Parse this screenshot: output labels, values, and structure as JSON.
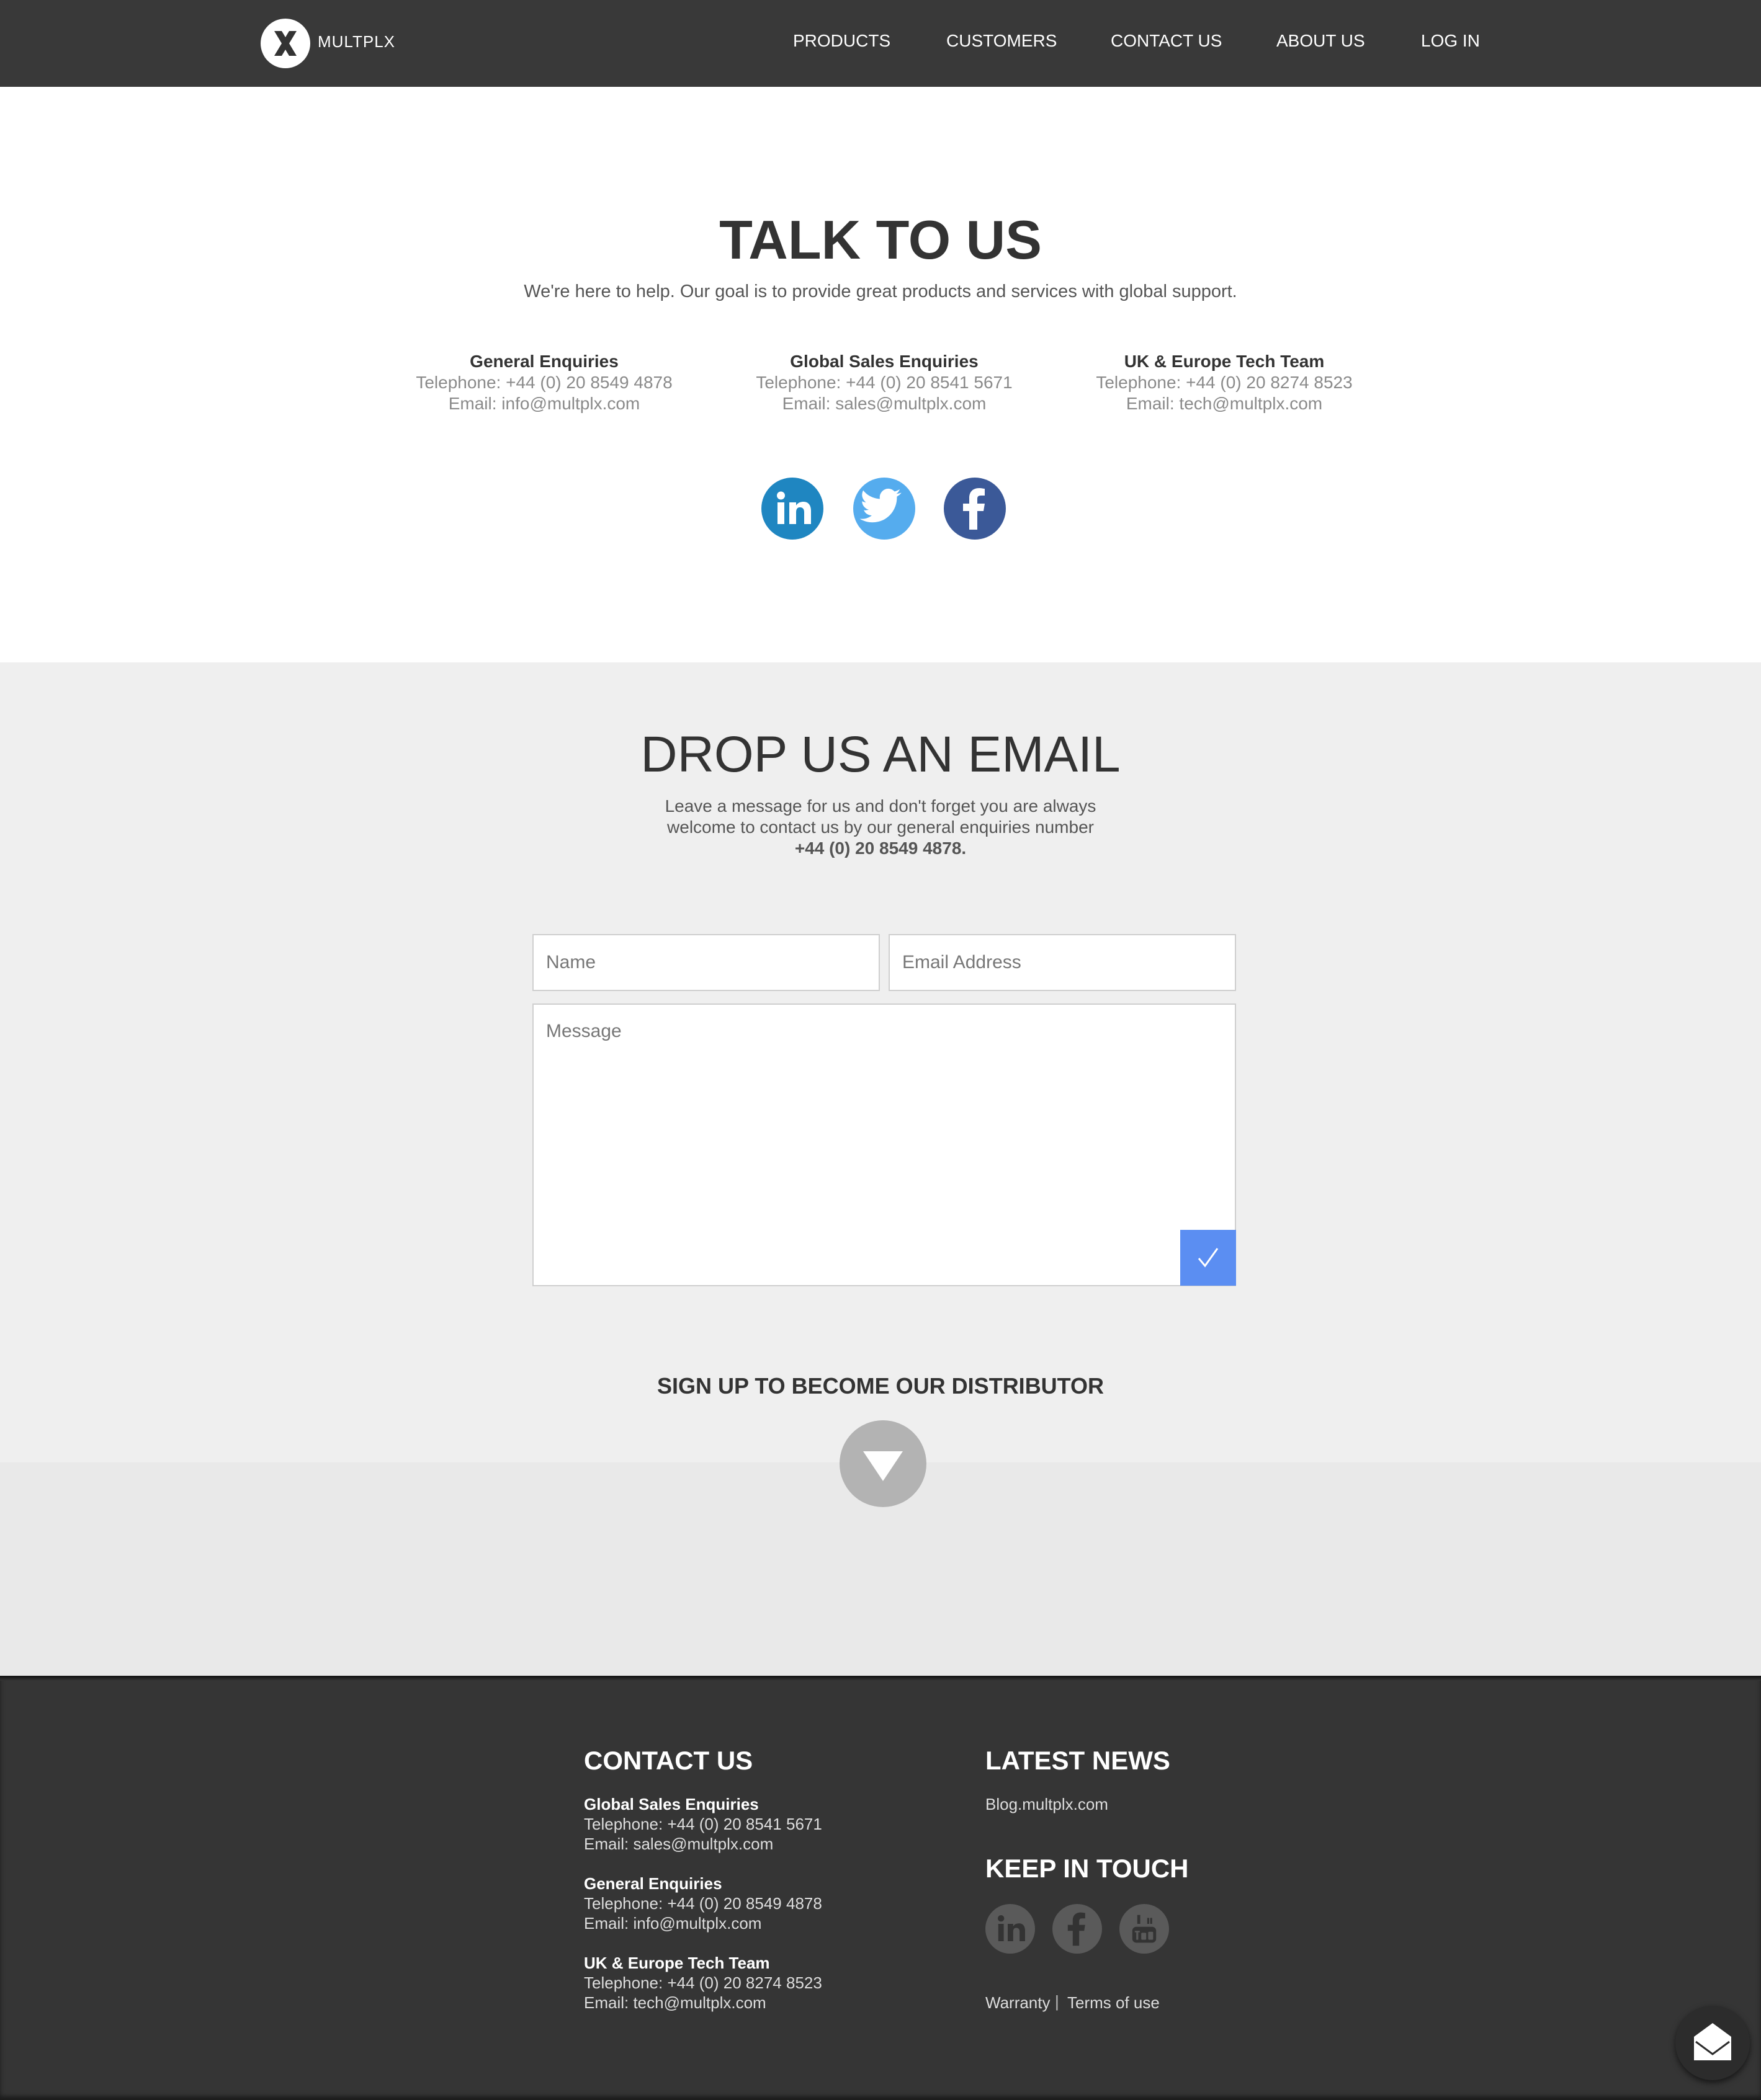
{
  "header": {
    "logo_text": "MULTPLX",
    "nav": [
      "PRODUCTS",
      "CUSTOMERS",
      "CONTACT US",
      "ABOUT US",
      "LOG IN"
    ]
  },
  "talk": {
    "title": "TALK TO US",
    "subtitle": "We're here to help. Our goal is to provide great products and services with global support.",
    "contacts": [
      {
        "title": "General Enquiries",
        "phone": "Telephone: +44 (0) 20 8549 4878",
        "email": "Email: info@multplx.com"
      },
      {
        "title": "Global Sales Enquiries",
        "phone": "Telephone: +44 (0) 20 8541 5671",
        "email": "Email: sales@multplx.com"
      },
      {
        "title": "UK & Europe Tech Team",
        "phone": "Telephone: +44 (0) 20 8274 8523",
        "email": "Email: tech@multplx.com"
      }
    ],
    "social_icons": [
      "linkedin-icon",
      "twitter-icon",
      "facebook-icon"
    ],
    "social_colors": [
      "#1f86c1",
      "#55acee",
      "#3b5998"
    ]
  },
  "drop": {
    "title": "DROP US AN EMAIL",
    "line1": "Leave a message for us and don't forget you are always",
    "line2": "welcome to contact us by our general enquiries number",
    "line3": "+44 (0) 20 8549 4878.",
    "name_placeholder": "Name",
    "email_placeholder": "Email Address",
    "message_placeholder": "Message",
    "send_icon": "checkmark-icon",
    "send_color": "#5b8ef2"
  },
  "signup": {
    "label": "SIGN UP TO BECOME OUR DISTRIBUTOR",
    "icon": "triangle-down-icon"
  },
  "footer": {
    "contact_heading": "CONTACT US",
    "contacts": [
      {
        "title": "Global Sales Enquiries",
        "phone": "Telephone: +44 (0) 20 8541 5671",
        "email": "Email: sales@multplx.com"
      },
      {
        "title": "General Enquiries",
        "phone": "Telephone: +44 (0) 20 8549 4878",
        "email": "Email: info@multplx.com"
      },
      {
        "title": "UK & Europe Tech Team",
        "phone": "Telephone: +44 (0) 20 8274 8523",
        "email": "Email: tech@multplx.com"
      }
    ],
    "news_heading": "LATEST NEWS",
    "blog_link": "Blog.multplx.com",
    "touch_heading": "KEEP IN TOUCH",
    "social_icons": [
      "linkedin-icon",
      "facebook-icon",
      "youtube-icon"
    ],
    "warranty": "Warranty",
    "separator": "|",
    "terms": "Terms of use"
  },
  "chat_icon": "envelope-icon"
}
